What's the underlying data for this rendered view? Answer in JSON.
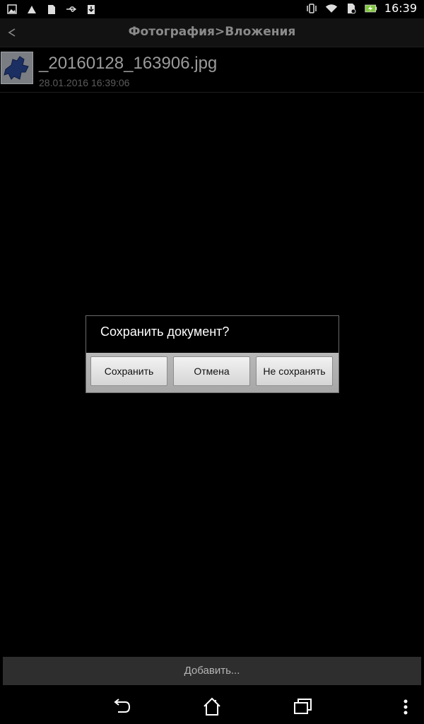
{
  "status_bar": {
    "time": "16:39",
    "left_icons": [
      "image-icon",
      "alert-icon",
      "sdcard-icon",
      "usb-icon",
      "download-icon"
    ],
    "right_icons": [
      "vibrate-icon",
      "wifi-icon",
      "sim-icon",
      "battery-charging-icon"
    ]
  },
  "action_bar": {
    "title": "Фотография>Вложения"
  },
  "file": {
    "name": "_20160128_163906.jpg",
    "date": "28.01.2016 16:39:06"
  },
  "dialog": {
    "message": "Сохранить документ?",
    "buttons": {
      "save": "Сохранить",
      "cancel": "Отмена",
      "dont_save": "Не сохранять"
    }
  },
  "bottom": {
    "add_label": "Добавить..."
  },
  "colors": {
    "background": "#000000",
    "dialog_button_bar": "#b0b0b0",
    "title_text": "#8a8a8a"
  }
}
